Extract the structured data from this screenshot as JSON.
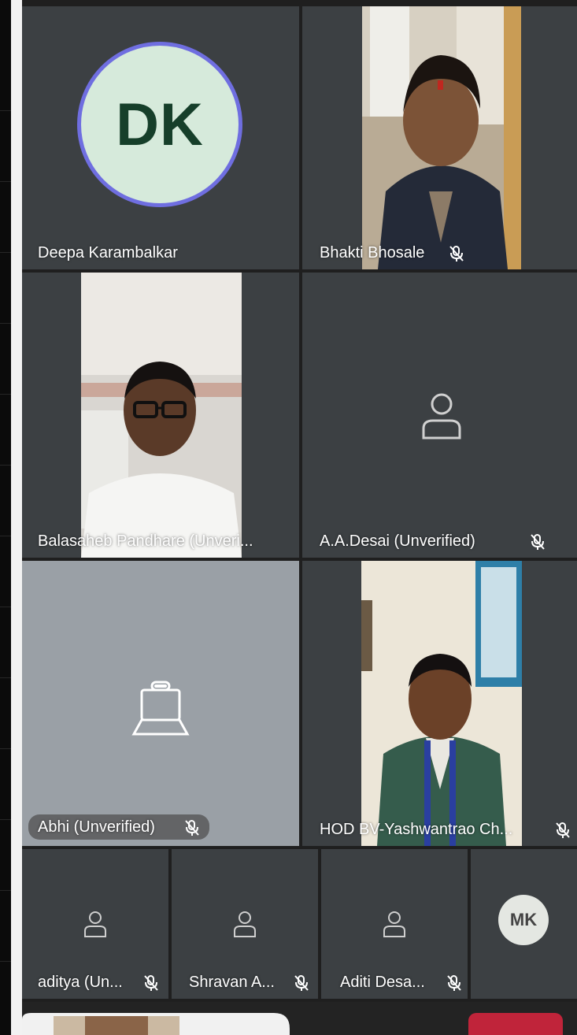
{
  "participants": {
    "deepa": {
      "initials": "DK",
      "name": "Deepa Karambalkar"
    },
    "bhakti": {
      "name": "Bhakti Bhosale"
    },
    "balasaheb": {
      "name": "Balasaheb Pandhare (Unveri..."
    },
    "aadesai": {
      "name": "A.A.Desai (Unverified)"
    },
    "abhi": {
      "name": "Abhi (Unverified)"
    },
    "hod": {
      "name": "HOD BV-Yashwantrao Ch..."
    },
    "aditya": {
      "name": "aditya (Un..."
    },
    "shravan": {
      "name": "Shravan A..."
    },
    "aditi": {
      "name": "Aditi Desa..."
    },
    "mk": {
      "initials": "MK"
    }
  },
  "icons": {
    "mic_off": "mic-off-icon",
    "person": "person-icon",
    "camera_off": "camera-off-icon"
  },
  "colors": {
    "tile_bg": "#3c4043",
    "avatar_ring": "#6f6ee0",
    "avatar_fill": "#d6eadb",
    "abhi_tile": "#9aa0a6",
    "leave_button": "#c0243a"
  }
}
